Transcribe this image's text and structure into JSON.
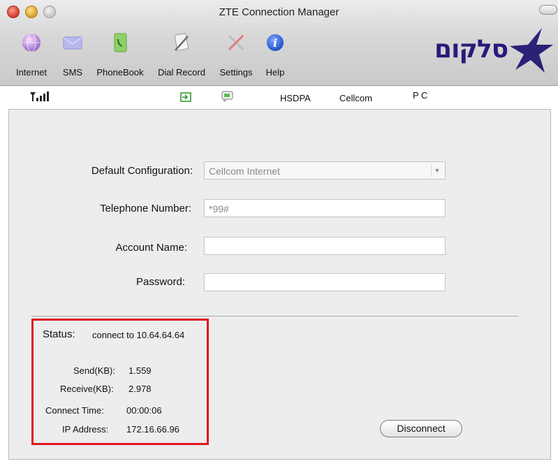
{
  "window": {
    "title": "ZTE Connection Manager"
  },
  "toolbar": {
    "items": [
      {
        "label": "Internet",
        "icon": "globe-icon"
      },
      {
        "label": "SMS",
        "icon": "envelope-icon"
      },
      {
        "label": "PhoneBook",
        "icon": "phonebook-icon"
      },
      {
        "label": "Dial Record",
        "icon": "dial-record-icon"
      },
      {
        "label": "Settings",
        "icon": "settings-tools-icon"
      },
      {
        "label": "Help",
        "icon": "info-icon"
      }
    ],
    "logo_text": "סלקום"
  },
  "status_strip": {
    "signal_icon": "signal-strength-icon",
    "network_type": "HSDPA",
    "operator": "Cellcom",
    "mode": "P C"
  },
  "form": {
    "default_configuration": {
      "label": "Default Configuration:",
      "value": "Cellcom Internet"
    },
    "telephone_number": {
      "label": "Telephone Number:",
      "value": "*99#"
    },
    "account_name": {
      "label": "Account Name:",
      "value": ""
    },
    "password": {
      "label": "Password:",
      "value": ""
    }
  },
  "status": {
    "label": "Status:",
    "value": "connect to 10.64.64.64",
    "send_label": "Send(KB):",
    "send_value": "1.559",
    "receive_label": "Receive(KB):",
    "receive_value": "2.978",
    "connect_time_label": "Connect Time:",
    "connect_time_value": "00:00:06",
    "ip_label": "IP Address:",
    "ip_value": "172.16.66.96"
  },
  "actions": {
    "disconnect_label": "Disconnect"
  },
  "colors": {
    "highlight_box": "#e0161e",
    "logo_blue": "#2a1a7a"
  }
}
